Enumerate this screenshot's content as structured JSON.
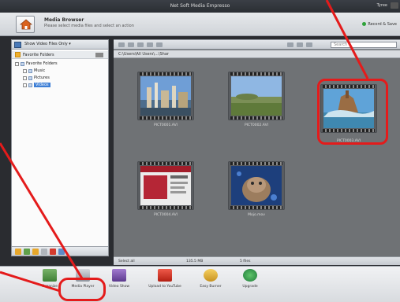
{
  "titlebar": {
    "title": "Net Soft Media Empresso",
    "user": "Tyree"
  },
  "header": {
    "title": "Media Browser",
    "subtitle": "Please select media files and select an action",
    "record_label": "Record & Save"
  },
  "left_panel": {
    "dropdown": "Show Video Files Only",
    "favorites_header": "Favorite Folders",
    "tree": [
      {
        "label": "Favorite Folders",
        "indent": 0,
        "selected": false
      },
      {
        "label": "Music",
        "indent": 1,
        "selected": false
      },
      {
        "label": "Pictures",
        "indent": 1,
        "selected": false
      },
      {
        "label": "Videos",
        "indent": 1,
        "selected": true
      }
    ]
  },
  "main": {
    "search_placeholder": "Search",
    "path": "C:\\Users\\All Users\\...\\Shar",
    "thumbnails": [
      {
        "caption": "PICT0001.AVI"
      },
      {
        "caption": "PICT0002.AVI"
      },
      {
        "caption": "PICT0003.AVI"
      },
      {
        "caption": "PICT0004.AVI"
      },
      {
        "caption": "Mojo.mov"
      }
    ]
  },
  "statusbar": {
    "select_all": "Select all",
    "size": "135.5 MB",
    "count": "5 files"
  },
  "dock": {
    "items": [
      {
        "label": "Organize"
      },
      {
        "label": "Media Player"
      },
      {
        "label": "Video Show"
      },
      {
        "label": "Upload to YouTube"
      },
      {
        "label": "Easy Burner"
      },
      {
        "label": "Upgrade"
      }
    ]
  },
  "colors": {
    "annotation": "#e41b1b",
    "selection": "#3d7fd6"
  }
}
